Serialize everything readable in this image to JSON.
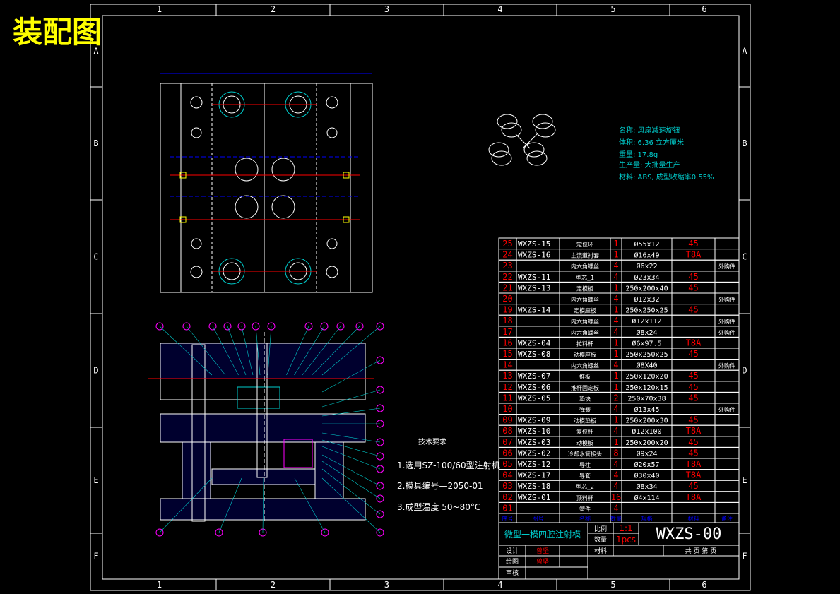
{
  "title": "装配图",
  "grid": {
    "columns": [
      "1",
      "2",
      "3",
      "4",
      "5",
      "6"
    ],
    "rows": [
      "A",
      "B",
      "C",
      "D",
      "E",
      "F"
    ]
  },
  "part_info": {
    "name": "名称: 风扇减速旋钮",
    "volume": "体积: 6.36 立方厘米",
    "weight": "重量: 17.8g",
    "production": "生产量: 大批量生产",
    "material": "材料: ABS, 成型收缩率0.55%"
  },
  "tech_requirements": {
    "heading": "技术要求",
    "items": [
      "1.选用SZ-100/60型注射机",
      "2.模具编号—2050-01",
      "3.成型温度 50~80°C"
    ]
  },
  "bom": {
    "headers": [
      "序号",
      "图号",
      "名称",
      "数量",
      "规格",
      "材料",
      "备注"
    ],
    "rows": [
      [
        "25",
        "WXZS-15",
        "定位环",
        "1",
        "Ø55x12",
        "45",
        ""
      ],
      [
        "24",
        "WXZS-16",
        "主流道衬套",
        "1",
        "Ø16x49",
        "T8A",
        ""
      ],
      [
        "23",
        "",
        "内六角螺丝",
        "4",
        "Ø6x22",
        "",
        "外购件"
      ],
      [
        "22",
        "WXZS-11",
        "型芯_1",
        "4",
        "Ø23x34",
        "45",
        ""
      ],
      [
        "21",
        "WXZS-13",
        "定模板",
        "1",
        "250x200x40",
        "45",
        ""
      ],
      [
        "20",
        "",
        "内六角螺丝",
        "4",
        "Ø12x32",
        "",
        "外购件"
      ],
      [
        "19",
        "WXZS-14",
        "定模座板",
        "1",
        "250x250x25",
        "45",
        ""
      ],
      [
        "18",
        "",
        "内六角螺丝",
        "4",
        "Ø12x112",
        "",
        "外购件"
      ],
      [
        "17",
        "",
        "内六角螺丝",
        "4",
        "Ø8x24",
        "",
        "外购件"
      ],
      [
        "16",
        "WXZS-04",
        "拉料杆",
        "1",
        "Ø6x97.5",
        "T8A",
        ""
      ],
      [
        "15",
        "WXZS-08",
        "动模座板",
        "1",
        "250x250x25",
        "45",
        ""
      ],
      [
        "14",
        "",
        "内六角螺丝",
        "4",
        "Ø8X40",
        "",
        "外购件"
      ],
      [
        "13",
        "WXZS-07",
        "推板",
        "1",
        "250x120x20",
        "45",
        ""
      ],
      [
        "12",
        "WXZS-06",
        "推杆固定板",
        "1",
        "250x120x15",
        "45",
        ""
      ],
      [
        "11",
        "WXZS-05",
        "垫块",
        "2",
        "250x70x38",
        "45",
        ""
      ],
      [
        "10",
        "",
        "弹簧",
        "4",
        "Ø13x45",
        "",
        "外购件"
      ],
      [
        "09",
        "WXZS-09",
        "动模垫板",
        "1",
        "250x200x30",
        "45",
        ""
      ],
      [
        "08",
        "WXZS-10",
        "复位杆",
        "4",
        "Ø12x100",
        "T8A",
        ""
      ],
      [
        "07",
        "WXZS-03",
        "动模板",
        "1",
        "250x200x20",
        "45",
        ""
      ],
      [
        "06",
        "WXZS-02",
        "冷却水管接头",
        "8",
        "Ø9x24",
        "45",
        ""
      ],
      [
        "05",
        "WXZS-12",
        "导柱",
        "4",
        "Ø20x57",
        "T8A",
        ""
      ],
      [
        "04",
        "WXZS-17",
        "导套",
        "4",
        "Ø30x40",
        "T8A",
        ""
      ],
      [
        "03",
        "WXZS-18",
        "型芯_2",
        "4",
        "Ø8x34",
        "45",
        ""
      ],
      [
        "02",
        "WXZS-01",
        "顶料杆",
        "16",
        "Ø4x114",
        "T8A",
        ""
      ],
      [
        "01",
        "",
        "塑件",
        "4",
        "",
        "",
        ""
      ]
    ]
  },
  "title_block": {
    "drawing_title": "微型一模四腔注射模",
    "scale_label": "比例",
    "scale_value": "1:1",
    "qty_label": "数量",
    "qty_value": "1pcs",
    "drawing_number": "WXZS-00",
    "designer_label": "设计",
    "designer": "曾坚",
    "drafter_label": "绘图",
    "drafter": "曾坚",
    "reviewer_label": "审核",
    "material_label": "材料",
    "sheets": "共 页 第 页"
  },
  "colors": {
    "frame": "#ffffff",
    "title": "#ffff00",
    "cyan": "#00c8c8",
    "red": "#ff0000",
    "blue": "#0000ff",
    "magenta": "#ff00ff"
  }
}
